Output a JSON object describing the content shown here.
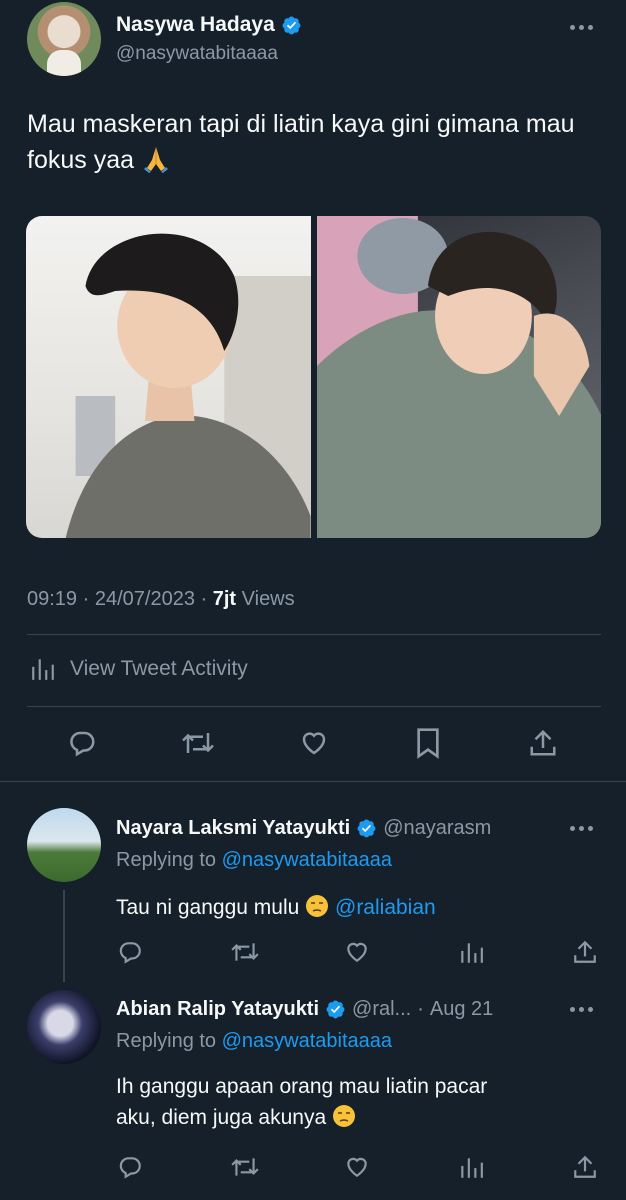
{
  "main_tweet": {
    "display_name": "Nasywa Hadaya",
    "handle": "@nasywatabitaaaa",
    "text": "Mau maskeran tapi di liatin kaya gini gimana mau fokus yaa",
    "emoji": "pray",
    "time": "09:19",
    "date": "24/07/2023",
    "views_count": "7jt",
    "views_label": "Views",
    "activity_label": "View Tweet Activity"
  },
  "replies": [
    {
      "display_name": "Nayara Laksmi Yatayukti",
      "handle": "@nayarasm",
      "replying_label": "Replying to",
      "replying_to": "@nasywatabitaaaa",
      "text": "Tau ni ganggu mulu",
      "mention": "@raliabian",
      "emoji": "unamused"
    },
    {
      "display_name": "Abian Ralip Yatayukti",
      "handle": "@ral...",
      "dot": "·",
      "date": "Aug 21",
      "replying_label": "Replying to",
      "replying_to": "@nasywatabitaaaa",
      "text_line1": "Ih ganggu apaan orang mau liatin pacar",
      "text_line2": "aku, diem juga akunya",
      "emoji": "unamused"
    }
  ],
  "icons": [
    "verified-icon",
    "more-icon",
    "reply-icon",
    "retweet-icon",
    "like-icon",
    "bookmark-icon",
    "share-icon",
    "analytics-icon"
  ],
  "colors": {
    "background": "#15202b",
    "text": "#f7f9f9",
    "muted": "#8b98a5",
    "link": "#1d9bf0",
    "divider": "#38444d"
  }
}
